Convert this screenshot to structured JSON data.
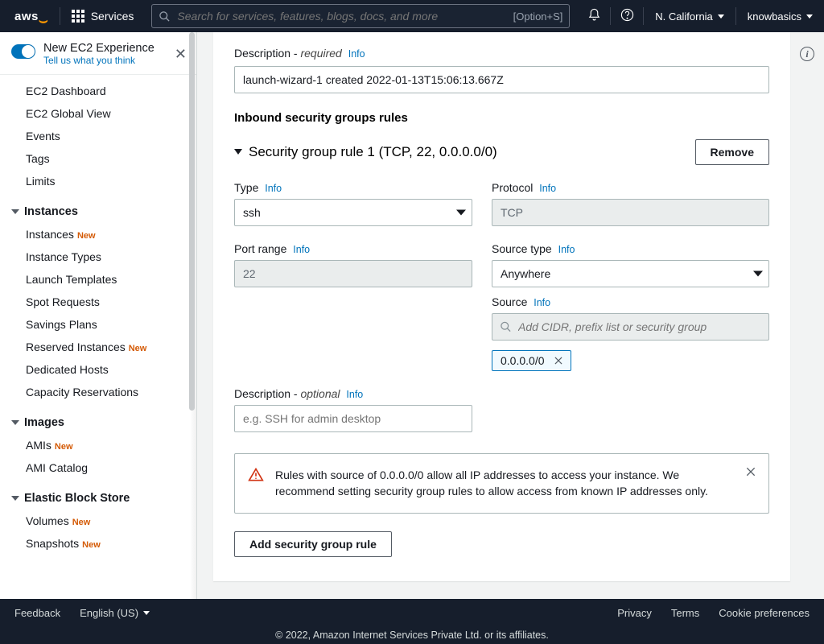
{
  "topnav": {
    "services": "Services",
    "search_placeholder": "Search for services, features, blogs, docs, and more",
    "shortcut": "[Option+S]",
    "region": "N. California",
    "account": "knowbasics"
  },
  "newexp": {
    "title": "New EC2 Experience",
    "sub": "Tell us what you think"
  },
  "sidenav": {
    "top": [
      "EC2 Dashboard",
      "EC2 Global View",
      "Events",
      "Tags",
      "Limits"
    ],
    "instances_h": "Instances",
    "instances": [
      {
        "label": "Instances",
        "new": true
      },
      {
        "label": "Instance Types",
        "new": false
      },
      {
        "label": "Launch Templates",
        "new": false
      },
      {
        "label": "Spot Requests",
        "new": false
      },
      {
        "label": "Savings Plans",
        "new": false
      },
      {
        "label": "Reserved Instances",
        "new": true
      },
      {
        "label": "Dedicated Hosts",
        "new": false
      },
      {
        "label": "Capacity Reservations",
        "new": false
      }
    ],
    "images_h": "Images",
    "images": [
      {
        "label": "AMIs",
        "new": true
      },
      {
        "label": "AMI Catalog",
        "new": false
      }
    ],
    "ebs_h": "Elastic Block Store",
    "ebs": [
      {
        "label": "Volumes",
        "new": true
      },
      {
        "label": "Snapshots",
        "new": true
      }
    ]
  },
  "form": {
    "desc_label": "Description - ",
    "desc_req": "required",
    "info": "Info",
    "desc_value": "launch-wizard-1 created 2022-01-13T15:06:13.667Z",
    "section": "Inbound security groups rules",
    "rule_title": "Security group rule 1 (TCP, 22, 0.0.0.0/0)",
    "remove": "Remove",
    "type_l": "Type",
    "type_v": "ssh",
    "protocol_l": "Protocol",
    "protocol_v": "TCP",
    "port_l": "Port range",
    "port_v": "22",
    "srctype_l": "Source type",
    "srctype_v": "Anywhere",
    "src_l": "Source",
    "src_ph": "Add CIDR, prefix list or security group",
    "src_tag": "0.0.0.0/0",
    "desc2_label": "Description - ",
    "desc2_opt": "optional",
    "desc2_ph": "e.g. SSH for admin desktop",
    "warn": "Rules with source of 0.0.0.0/0 allow all IP addresses to access your instance. We recommend setting security group rules to allow access from known IP addresses only.",
    "add": "Add security group rule"
  },
  "footer": {
    "feedback": "Feedback",
    "lang": "English (US)",
    "privacy": "Privacy",
    "terms": "Terms",
    "cookies": "Cookie preferences",
    "copy": "© 2022, Amazon Internet Services Private Ltd. or its affiliates."
  },
  "badge_new": "New"
}
